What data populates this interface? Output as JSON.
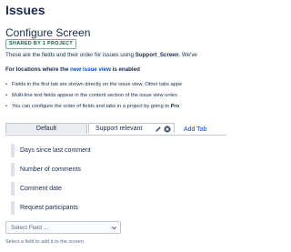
{
  "page": {
    "title": "Issues"
  },
  "screen": {
    "title": "Configure Screen",
    "badge": "SHARED BY 1 PROJECT",
    "intro_prefix": "These are the fields and their order for issues using ",
    "intro_screen_name": "Support_Screen",
    "intro_suffix": ". We've"
  },
  "subhead": {
    "prefix": "For locations where the ",
    "link": "new issue view",
    "suffix": " is enabled"
  },
  "bullets": [
    {
      "text": "Fields in the first tab are shown directly on the issue view. Other tabs appe",
      "bold": ""
    },
    {
      "text": "Multi-line text fields appear in the content section of the issue view unles",
      "bold": ""
    },
    {
      "text": "You can configure the order of fields and tabs in a project by going to ",
      "bold": "Pro"
    }
  ],
  "tabs": [
    {
      "label": "Default"
    },
    {
      "label": "Support relevant"
    }
  ],
  "add_tab_label": "Add Tab",
  "fields": [
    {
      "label": "Days since last comment"
    },
    {
      "label": "Number of comments"
    },
    {
      "label": "Comment date"
    },
    {
      "label": "Request participants"
    }
  ],
  "select": {
    "placeholder": "Select Field ..."
  },
  "help_text": "Select a field to add it to the screen.",
  "icons": {
    "edit": "pencil-icon",
    "close": "close-circle-icon",
    "dropdown": "chevron-down-icon",
    "drag": "drag-handle"
  },
  "colors": {
    "link": "#0052cc",
    "badge_text": "#006644",
    "badge_border": "#79b391",
    "text": "#172b4d"
  }
}
